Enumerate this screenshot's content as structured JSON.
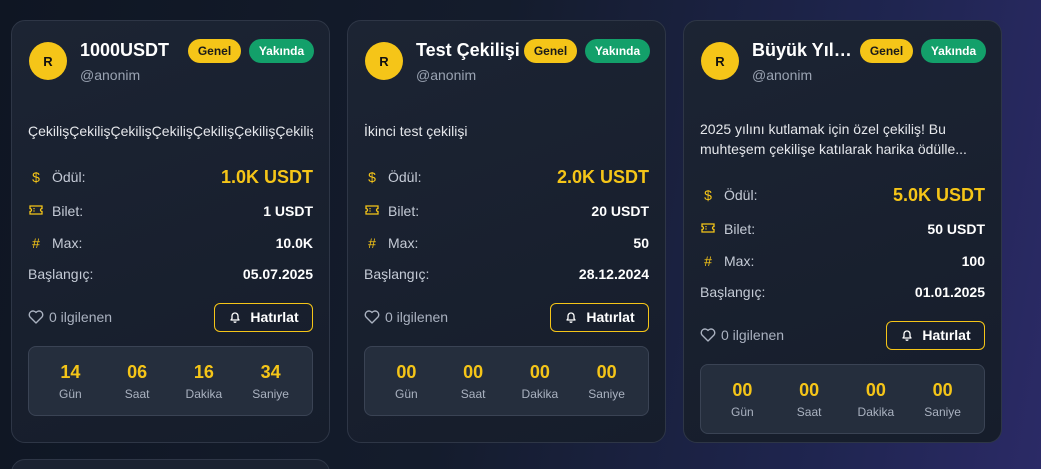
{
  "cards": [
    {
      "avatar": "R",
      "title": "1000USDT",
      "handle": "@anonim",
      "badge_category": "Genel",
      "badge_status": "Yakında",
      "description": "ÇekilişÇekilişÇekilişÇekilişÇekilişÇekilişÇekiliş",
      "prize_label": "Ödül:",
      "prize_value": "1.0K USDT",
      "ticket_label": "Bilet:",
      "ticket_value": "1 USDT",
      "max_label": "Max:",
      "max_value": "10.0K",
      "start_label": "Başlangıç:",
      "start_value": "05.07.2025",
      "interest": "0 ilgilenen",
      "remind_label": "Hatırlat",
      "countdown": [
        {
          "num": "14",
          "label": "Gün"
        },
        {
          "num": "06",
          "label": "Saat"
        },
        {
          "num": "16",
          "label": "Dakika"
        },
        {
          "num": "34",
          "label": "Saniye"
        }
      ]
    },
    {
      "avatar": "R",
      "title": "Test Çekilişi",
      "handle": "@anonim",
      "badge_category": "Genel",
      "badge_status": "Yakında",
      "description": "İkinci test çekilişi",
      "prize_label": "Ödül:",
      "prize_value": "2.0K USDT",
      "ticket_label": "Bilet:",
      "ticket_value": "20 USDT",
      "max_label": "Max:",
      "max_value": "50",
      "start_label": "Başlangıç:",
      "start_value": "28.12.2024",
      "interest": "0 ilgilenen",
      "remind_label": "Hatırlat",
      "countdown": [
        {
          "num": "00",
          "label": "Gün"
        },
        {
          "num": "00",
          "label": "Saat"
        },
        {
          "num": "00",
          "label": "Dakika"
        },
        {
          "num": "00",
          "label": "Saniye"
        }
      ]
    },
    {
      "avatar": "R",
      "title": "Büyük Yılbaşı Çekilişi",
      "handle": "@anonim",
      "badge_category": "Genel",
      "badge_status": "Yakında",
      "description": "2025 yılını kutlamak için özel çekiliş! Bu muhteşem çekilişe katılarak harika ödülle...",
      "prize_label": "Ödül:",
      "prize_value": "5.0K USDT",
      "ticket_label": "Bilet:",
      "ticket_value": "50 USDT",
      "max_label": "Max:",
      "max_value": "100",
      "start_label": "Başlangıç:",
      "start_value": "01.01.2025",
      "interest": "0 ilgilenen",
      "remind_label": "Hatırlat",
      "countdown": [
        {
          "num": "00",
          "label": "Gün"
        },
        {
          "num": "00",
          "label": "Saat"
        },
        {
          "num": "00",
          "label": "Dakika"
        },
        {
          "num": "00",
          "label": "Saniye"
        }
      ]
    }
  ],
  "icons": {
    "prize": "dollar-icon",
    "ticket": "ticket-icon",
    "max": "hash-icon",
    "interest": "heart-icon",
    "remind": "bell-icon"
  },
  "colors": {
    "accent": "#f5c518",
    "status_green": "#13a06a",
    "card_bg": "#1c2433"
  }
}
